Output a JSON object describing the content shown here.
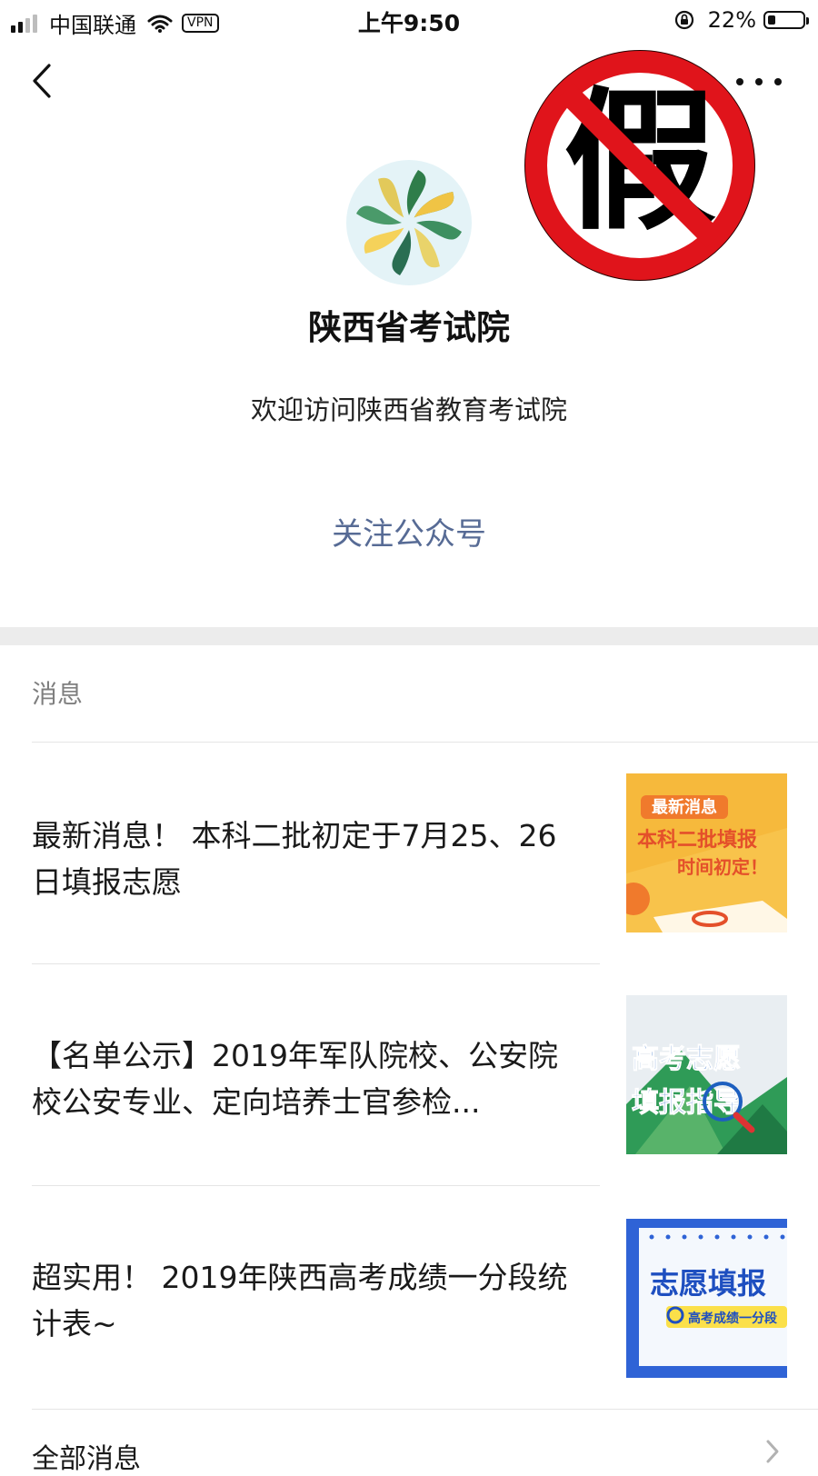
{
  "status_bar": {
    "carrier": "中国联通",
    "vpn": "VPN",
    "time": "上午9:50",
    "battery_percent": "22%",
    "battery_level": 0.22
  },
  "account": {
    "name": "陕西省考试院",
    "intro": "欢迎访问陕西省教育考试院",
    "follow_label": "关注公众号"
  },
  "stamp": {
    "text": "假",
    "color": "#e0141b"
  },
  "messages": {
    "section_title": "消息",
    "items": [
      {
        "title": "最新消息！ 本科二批初定于7月25、26日填报志愿",
        "thumb": {
          "line1": "最新消息",
          "line2": "本科二批填报",
          "line3": "时间初定！"
        }
      },
      {
        "title": "【名单公示】2019年军队院校、公安院校公安专业、定向培养士官参检...",
        "thumb": {
          "line1": "高考志愿",
          "line2": "填报指导"
        }
      },
      {
        "title": "超实用！ 2019年陕西高考成绩一分段统计表~",
        "thumb": {
          "line1": "志愿填报",
          "line2": "高考成绩一分段"
        }
      }
    ],
    "all_label": "全部消息"
  },
  "colors": {
    "link_blue": "#576b95",
    "section_gray": "#7f7f7f",
    "band_gray": "#ececec"
  }
}
